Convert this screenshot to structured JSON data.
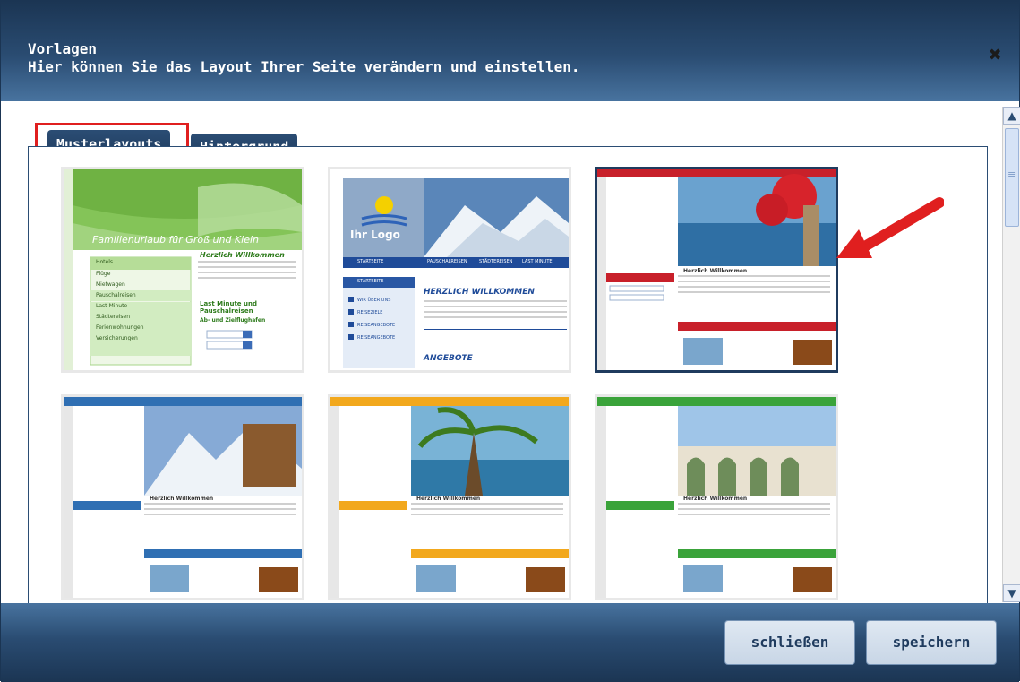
{
  "dialog": {
    "title": "Vorlagen",
    "subtitle": "Hier können Sie das Layout Ihrer Seite verändern und einstellen.",
    "close_symbol": "✖"
  },
  "tabs": [
    {
      "label": "Musterlayouts",
      "active": true
    },
    {
      "label": "Hintergrund",
      "active": false
    }
  ],
  "templates": [
    {
      "id": "t1",
      "banner_text": "Familienurlaub für Groß und Klein",
      "heading": "Herzlich Willkommen",
      "menu": [
        "Hotels",
        "Flüge",
        "Mietwagen",
        "Pauschalreisen",
        "Last-Minute",
        "Städtereisen",
        "Ferienwohnungen",
        "Versicherungen"
      ],
      "section": "Last Minute und Pauschalreisen",
      "section2": "Ab- und Zielflughafen",
      "accent": "#5aa332",
      "selected": false
    },
    {
      "id": "t2",
      "logo_text": "Ihr Logo",
      "nav": [
        "STARTSEITE",
        "PAUSCHALREISEN",
        "STÄDTEREISEN",
        "LAST MINUTE"
      ],
      "heading": "HERZLICH WILLKOMMEN",
      "sidebar": [
        "STARTSEITE",
        "WIR ÜBER UNS",
        "REISEZIELE",
        "REISEANGEBOTE",
        "REISEANGEBOTE"
      ],
      "footer_heading": "ANGEBOTE",
      "accent": "#2957a4",
      "selected": false
    },
    {
      "id": "t3",
      "heading": "Herzlich Willkommen",
      "accent": "#c8202a",
      "selected": true
    },
    {
      "id": "t4",
      "heading": "Herzlich Willkommen",
      "accent": "#2f6fb3",
      "selected": false
    },
    {
      "id": "t5",
      "heading": "Herzlich Willkommen",
      "accent": "#f2a81d",
      "selected": false
    },
    {
      "id": "t6",
      "heading": "Herzlich Willkommen",
      "accent": "#3aa33a",
      "selected": false
    }
  ],
  "buttons": {
    "close": "schließen",
    "save": "speichern"
  },
  "scroll": {
    "up_icon": "chevron-up-icon",
    "down_icon": "chevron-down-icon"
  },
  "colors": {
    "header_dark": "#1b3553",
    "tab_bg": "#2b4d74",
    "highlight_red": "#e01f1f",
    "arrow_red": "#e01f1f"
  }
}
